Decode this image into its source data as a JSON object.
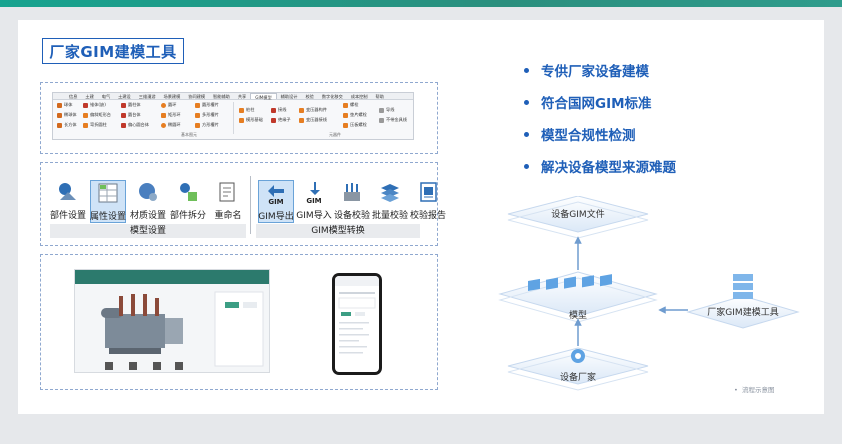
{
  "header": {
    "title": "厂家GIM建模工具"
  },
  "ribbon": {
    "tabs": [
      {
        "label": "信息",
        "active": false
      },
      {
        "label": "土建",
        "active": false
      },
      {
        "label": "电气",
        "active": false
      },
      {
        "label": "土建设",
        "active": false
      },
      {
        "label": "三维漫游",
        "active": false
      },
      {
        "label": "场景建模",
        "active": false
      },
      {
        "label": "协同建模",
        "active": false
      },
      {
        "label": "智能辅助",
        "active": false
      },
      {
        "label": "共享",
        "active": false
      },
      {
        "label": "GIM模型",
        "active": true
      },
      {
        "label": "辅助设计",
        "active": false
      },
      {
        "label": "校验",
        "active": false
      },
      {
        "label": "数字化移交",
        "active": false
      },
      {
        "label": "成本控制",
        "active": false
      },
      {
        "label": "帮助",
        "active": false
      }
    ],
    "col1": [
      "球体",
      "椭球体",
      "长方体"
    ],
    "col2": [
      "锥体(缺)",
      "偏斜矩形台",
      "弯折圆柱"
    ],
    "col3": [
      "圆柱体",
      "圆台体",
      "偏心圆台体"
    ],
    "col4": [
      "圆环",
      "矩形环",
      "椭圆环"
    ],
    "col5": [
      "圆形槽片",
      "多形槽片",
      "方形槽片"
    ],
    "col6": [
      "桩柱",
      "模形基础"
    ],
    "col7": [
      "接线",
      "绝缘子"
    ],
    "col8": [
      "变压器构件",
      "变压器接线"
    ],
    "col9": [
      "螺栓",
      "垫片螺栓",
      "压板螺栓"
    ],
    "col10": [
      "导线",
      "不带金具线"
    ],
    "group1": "基本图元",
    "group2": "元器件"
  },
  "tools": {
    "items": [
      {
        "label": "部件设置",
        "icon": "part-settings-icon",
        "selected": false
      },
      {
        "label": "属性设置",
        "icon": "property-settings-icon",
        "selected": true
      },
      {
        "label": "材质设置",
        "icon": "material-settings-icon",
        "selected": false
      },
      {
        "label": "部件拆分",
        "icon": "part-split-icon",
        "selected": false
      },
      {
        "label": "重命名",
        "icon": "rename-icon",
        "selected": false
      },
      {
        "label": "GIM导出",
        "icon": "gim-export-icon",
        "selected": true,
        "badge": "GIM"
      },
      {
        "label": "GIM导入",
        "icon": "gim-import-icon",
        "selected": false,
        "badge": "GIM"
      },
      {
        "label": "设备校验",
        "icon": "device-check-icon",
        "selected": false
      },
      {
        "label": "批量校验",
        "icon": "batch-check-icon",
        "selected": false
      },
      {
        "label": "校验报告",
        "icon": "check-report-icon",
        "selected": false
      }
    ],
    "group_model": "模型设置",
    "group_gim": "GIM模型转换"
  },
  "bullets": [
    "专供厂家设备建模",
    "符合国网GIM标准",
    "模型合规性检测",
    "解决设备模型来源难题"
  ],
  "diagram": {
    "top": "设备GIM文件",
    "middle": "模型",
    "bottom": "设备厂家",
    "right": "厂家GIM建模工具"
  },
  "note": "流程示意图",
  "colors": {
    "accent": "#1f5fb8",
    "topbar": "#17a38f"
  }
}
